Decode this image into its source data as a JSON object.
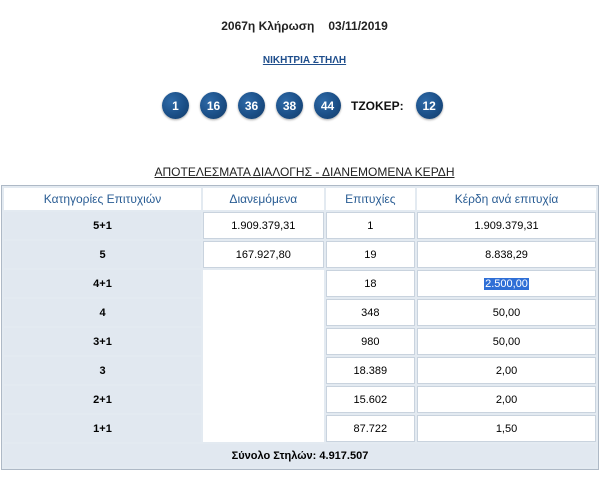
{
  "draw": {
    "number_label": "2067η Κλήρωση",
    "date": "03/11/2019"
  },
  "winning_link": "ΝΙΚΗΤΡΙΑ ΣΤΗΛΗ",
  "numbers": [
    "1",
    "16",
    "36",
    "38",
    "44"
  ],
  "joker": {
    "label": "ΤΖΟΚΕΡ:",
    "value": "12"
  },
  "results_title": "ΑΠΟΤΕΛΕΣΜΑΤΑ ΔΙΑΛΟΓΗΣ - ΔΙΑΝΕΜΟΜΕΝΑ ΚΕΡΔΗ",
  "table": {
    "headers": [
      "Κατηγορίες Επιτυχιών",
      "Διανεμόμενα",
      "Επιτυχίες",
      "Κέρδη ανά επιτυχία"
    ],
    "rows": [
      {
        "category": "5+1",
        "distributed": "1.909.379,31",
        "winners": "1",
        "prize": "1.909.379,31"
      },
      {
        "category": "5",
        "distributed": "167.927,80",
        "winners": "19",
        "prize": "8.838,29"
      },
      {
        "category": "4+1",
        "distributed": "",
        "winners": "18",
        "prize": "2.500,00"
      },
      {
        "category": "4",
        "distributed": "",
        "winners": "348",
        "prize": "50,00"
      },
      {
        "category": "3+1",
        "distributed": "",
        "winners": "980",
        "prize": "50,00"
      },
      {
        "category": "3",
        "distributed": "",
        "winners": "18.389",
        "prize": "2,00"
      },
      {
        "category": "2+1",
        "distributed": "",
        "winners": "15.602",
        "prize": "2,00"
      },
      {
        "category": "1+1",
        "distributed": "",
        "winners": "87.722",
        "prize": "1,50"
      }
    ],
    "total": "Σύνολο Στηλών: 4.917.507"
  },
  "colors": {
    "ball": "#1b4f87",
    "header_text": "#2a5d94",
    "table_bg": "#e3eaf1",
    "selection": "#2f6fd6"
  }
}
